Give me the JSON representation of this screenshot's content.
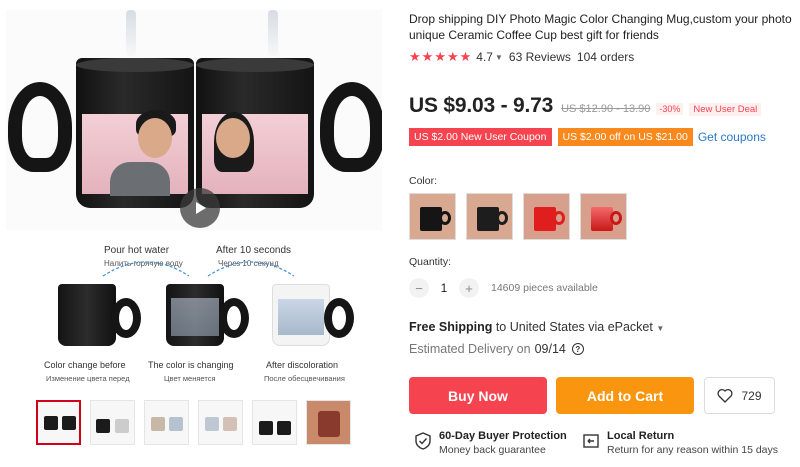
{
  "product": {
    "title": "Drop shipping DIY Photo Magic Color Changing Mug,custom your photo unique Ceramic Coffee Cup best gift for friends",
    "rating": "4.7",
    "rating_stars": 5,
    "reviews": "63 Reviews",
    "orders": "104 orders"
  },
  "price": {
    "current": "US $9.03 - 9.73",
    "original": "US $12.90 - 13.90",
    "discount": "-30%",
    "new_user_deal": "New User Deal"
  },
  "coupons": {
    "new_user_coupon": "US $2.00 New User Coupon",
    "store_coupon": "US $2.00 off on US $21.00",
    "get_coupons": "Get coupons"
  },
  "color": {
    "label": "Color:",
    "options": [
      "black-mug",
      "black-mug-alt",
      "red-mug",
      "red-mug-gradient"
    ]
  },
  "quantity": {
    "label": "Quantity:",
    "value": "1",
    "available": "14609 pieces available"
  },
  "shipping": {
    "free_label": "Free Shipping",
    "to_text": "to United States via ePacket",
    "delivery_label": "Estimated Delivery on",
    "delivery_date": "09/14"
  },
  "actions": {
    "buy_now": "Buy Now",
    "add_to_cart": "Add to Cart",
    "wishlist_count": "729"
  },
  "guarantees": {
    "protection_title": "60-Day Buyer Protection",
    "protection_sub": "Money back guarantee",
    "return_title": "Local Return",
    "return_sub": "Return for any reason within 15 days"
  },
  "gallery": {
    "step1_title": "Pour hot water",
    "step1_ru": "Налить горячую воду",
    "step2_title": "After 10 seconds",
    "step2_ru": "Через 10 секунд",
    "caption1": "Color change before",
    "caption1_ru": "Изменение цвета перед",
    "caption2": "The color is changing",
    "caption2_ru": "Цвет меняется",
    "caption3": "After discoloration",
    "caption3_ru": "После обесцвечивания",
    "thumbnail_count": 6
  },
  "colors": {
    "accent_red": "#f5434f",
    "accent_orange": "#f9950f",
    "link_blue": "#2979c8"
  }
}
